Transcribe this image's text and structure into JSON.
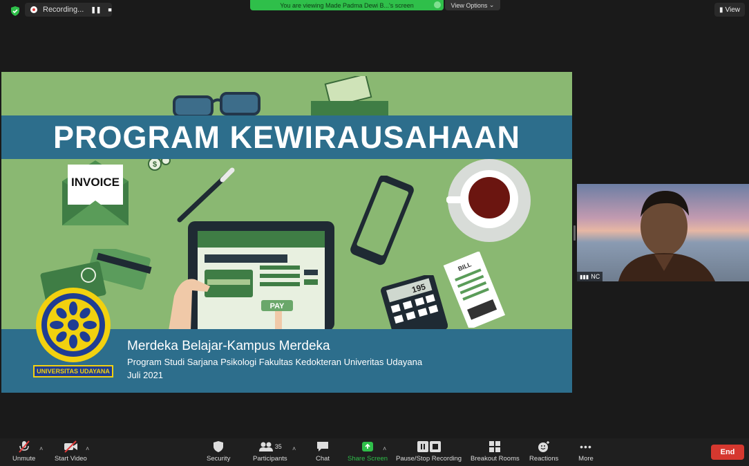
{
  "topbar": {
    "recording_label": "Recording...",
    "banner_text": "You are viewing Made Padma Dewi B...'s screen",
    "view_options_label": "View Options",
    "view_label": "View"
  },
  "slide": {
    "title": "PROGRAM KEWIRAUSAHAAN",
    "subtitle": "Merdeka Belajar-Kampus Merdeka",
    "line1": "Program Studi Sarjana Psikologi Fakultas Kedokteran Univeritas Udayana",
    "line2": "Juli 2021",
    "logo_caption": "UNIVERSITAS UDAYANA",
    "invoice": "INVOICE",
    "pay": "PAY",
    "bill": "BILL",
    "calc_display": "195"
  },
  "participant": {
    "name": "NC"
  },
  "toolbar": {
    "unmute": "Unmute",
    "start_video": "Start Video",
    "security": "Security",
    "participants": "Participants",
    "participants_count": "35",
    "chat": "Chat",
    "share_screen": "Share Screen",
    "pause_recording": "Pause/Stop Recording",
    "breakout_rooms": "Breakout Rooms",
    "reactions": "Reactions",
    "more": "More",
    "end": "End"
  },
  "colors": {
    "slide_green": "#8ab872",
    "slide_blue_band": "#2d6e8c",
    "banner_green": "#2fbf4a",
    "end_red": "#d6382f",
    "share_green": "#2fbf4a"
  }
}
